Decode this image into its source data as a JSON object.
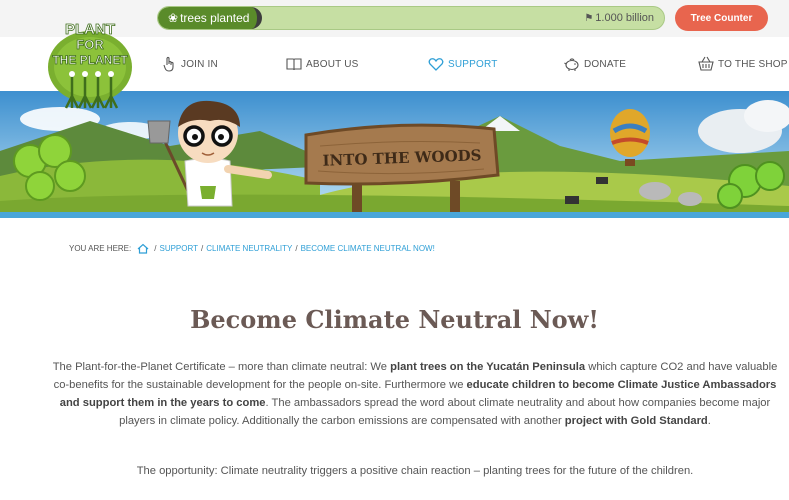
{
  "topbar": {
    "trees_planted_label": "trees planted",
    "goal_label": "1.000 billion",
    "tree_counter_button": "Tree Counter",
    "progress_fraction": 0.2
  },
  "logo": {
    "line1": "PLANT",
    "line2": "FOR",
    "line3": "THE PLANET"
  },
  "nav": {
    "items": [
      {
        "label": "JOIN IN",
        "icon": "hand-pointer-icon"
      },
      {
        "label": "ABOUT US",
        "icon": "book-icon"
      },
      {
        "label": "SUPPORT",
        "icon": "heart-icon",
        "active": true
      },
      {
        "label": "DONATE",
        "icon": "piggy-bank-icon"
      },
      {
        "label": "TO THE SHOP",
        "icon": "shopping-basket-icon"
      }
    ]
  },
  "banner": {
    "sign_text": "INTO THE WOODS"
  },
  "breadcrumb": {
    "label": "YOU ARE HERE:",
    "items": [
      "SUPPORT",
      "CLIMATE NEUTRALITY",
      "BECOME CLIMATE NEUTRAL NOW!"
    ]
  },
  "content": {
    "title": "Become Climate Neutral Now!",
    "p1_a": "The Plant-for-the-Planet Certificate – more than climate neutral: We ",
    "p1_b": "plant trees on the Yucatán Peninsula",
    "p1_c": " which capture CO2 and have valuable co-benefits for the sustainable development for the people on-site. Furthermore we ",
    "p1_d": "educate children to become Climate Justice Ambassadors and support them in the years to come",
    "p1_e": ". The ambassadors spread the word about climate neutrality and about how companies become major players in climate policy. Additionally the carbon emissions are compensated with another ",
    "p1_f": "project with Gold Standard",
    "p1_g": ".",
    "p2": "The opportunity: Climate neutrality triggers a positive chain reaction – planting trees for the future of the children."
  },
  "colors": {
    "accent_blue": "#2f9fd6",
    "tree_green": "#5a8b2a",
    "counter_button": "#e8654e",
    "title_color": "#6b5a55"
  }
}
